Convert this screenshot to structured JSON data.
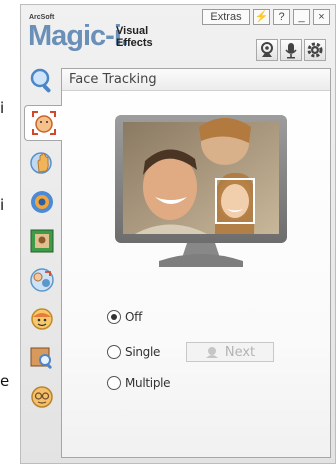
{
  "side_glyphs": [
    "i",
    "i",
    "e"
  ],
  "brand": {
    "small": "ArcSoft",
    "main": "Magic-i.",
    "sub_line1": "Visual",
    "sub_line2": "Effects"
  },
  "title_buttons": {
    "extras": "Extras",
    "flash": "⚡",
    "help": "?",
    "minimize": "_",
    "close": "×"
  },
  "mode_icons": [
    "webcam-icon",
    "microphone-icon",
    "gear-icon"
  ],
  "tabs": [
    {
      "name": "zoom",
      "icon": "magnifier-icon",
      "color": "#5b8fd0"
    },
    {
      "name": "face-tracking",
      "icon": "face-frame-icon",
      "color": "#e0854a",
      "active": true
    },
    {
      "name": "hands",
      "icon": "waving-hand-icon",
      "color": "#e9b54a"
    },
    {
      "name": "lens",
      "icon": "lens-icon",
      "color": "#3e8ad8"
    },
    {
      "name": "frame",
      "icon": "picture-frame-icon",
      "color": "#3f9a4a"
    },
    {
      "name": "avatar-swap",
      "icon": "avatar-swap-icon",
      "color": "#5c97c9"
    },
    {
      "name": "emotion",
      "icon": "face-emotion-icon",
      "color": "#f0a63a"
    },
    {
      "name": "photo-search",
      "icon": "photo-magnifier-icon",
      "color": "#b07a4a"
    },
    {
      "name": "face-mask",
      "icon": "mask-face-icon",
      "color": "#f2b554"
    }
  ],
  "panel": {
    "title": "Face Tracking",
    "options": [
      {
        "label": "Off",
        "selected": true
      },
      {
        "label": "Single",
        "selected": false
      },
      {
        "label": "Multiple",
        "selected": false
      }
    ],
    "next_label": "Next"
  }
}
